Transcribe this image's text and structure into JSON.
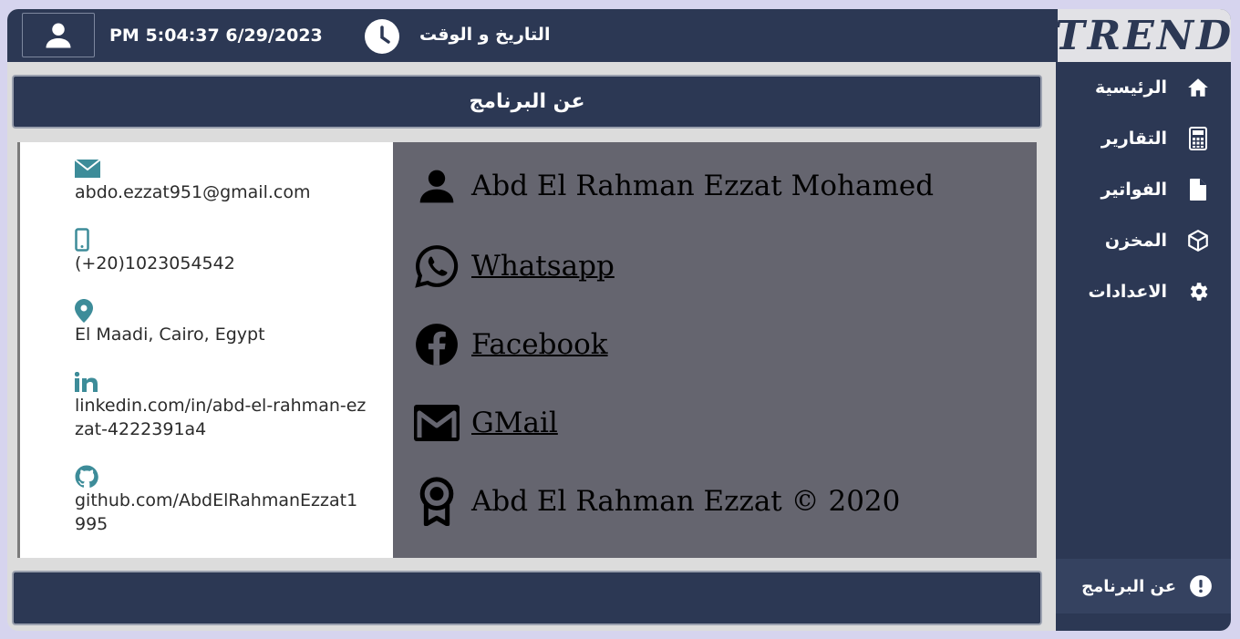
{
  "header": {
    "datetime": "PM 5:04:37 6/29/2023",
    "datetime_label": "التاريخ و الوقت"
  },
  "logo_text": "TREND",
  "sidebar": {
    "items": [
      {
        "label": "الرئيسية",
        "icon": "home-icon"
      },
      {
        "label": "التقارير",
        "icon": "calculator-icon"
      },
      {
        "label": "الفواتير",
        "icon": "file-icon"
      },
      {
        "label": "المخزن",
        "icon": "box-icon"
      },
      {
        "label": "الاعدادات",
        "icon": "gear-icon"
      }
    ],
    "about_label": "عن البرنامج"
  },
  "main": {
    "title": "عن البرنامج",
    "contact": {
      "email": "abdo.ezzat951@gmail.com",
      "phone": "(+20)1023054542",
      "location": "El Maadi, Cairo, Egypt",
      "linkedin": "linkedin.com/in/abd-el-rahman-ezzat-4222391a4",
      "github": "github.com/AbdElRahmanEzzat1995"
    },
    "profile": {
      "name": "Abd El Rahman Ezzat Mohamed",
      "whatsapp": "Whatsapp",
      "facebook": "Facebook",
      "gmail": "GMail",
      "copyright": "Abd El Rahman Ezzat © 2020"
    }
  },
  "colors": {
    "navy": "#2c3854",
    "teal": "#3d8c99",
    "panel_gray": "#65656f",
    "background": "#d6d4ee"
  }
}
